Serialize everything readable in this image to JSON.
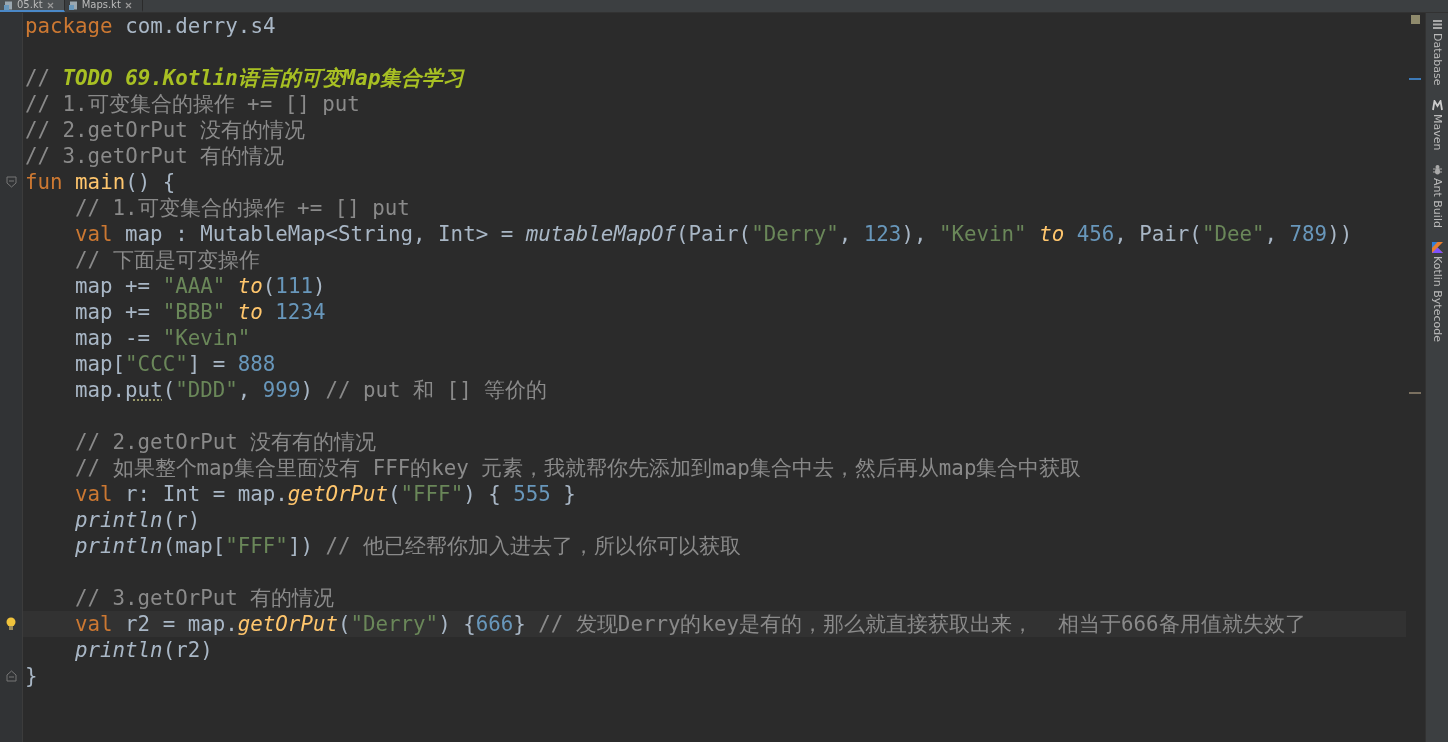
{
  "tabs": [
    {
      "label": "05.kt",
      "selected": true
    },
    {
      "label": "Maps.kt",
      "selected": false
    }
  ],
  "editor": {
    "lines": [
      {
        "kind": "code",
        "tokens": [
          {
            "kind": "kw",
            "text": "package"
          },
          {
            "kind": "txt",
            "text": " com.derry.s4"
          }
        ]
      },
      {
        "kind": "blank"
      },
      {
        "kind": "code",
        "tokens": [
          {
            "kind": "cmt",
            "text": "// "
          },
          {
            "kind": "todo",
            "text": "TODO 69.Kotlin语言的可变Map集合学习"
          }
        ]
      },
      {
        "kind": "code",
        "tokens": [
          {
            "kind": "cmt",
            "text": "// 1.可变集合的操作 += [] put"
          }
        ]
      },
      {
        "kind": "code",
        "tokens": [
          {
            "kind": "cmt",
            "text": "// 2.getOrPut 没有的情况"
          }
        ]
      },
      {
        "kind": "code",
        "tokens": [
          {
            "kind": "cmt",
            "text": "// 3.getOrPut 有的情况"
          }
        ]
      },
      {
        "kind": "code",
        "gutter_icon": {
          "kind": "fold-start"
        },
        "tokens": [
          {
            "kind": "kw",
            "text": "fun "
          },
          {
            "kind": "decl",
            "text": "main"
          },
          {
            "kind": "txt",
            "text": "() {"
          }
        ],
        "children": [
          {
            "kind": "code",
            "tokens": [
              {
                "kind": "cmt",
                "text": "// 1.可变集合的操作 += [] put"
              }
            ]
          },
          {
            "kind": "code",
            "tokens": [
              {
                "kind": "kw",
                "text": "val"
              },
              {
                "kind": "txt",
                "text": " map : MutableMap<String, Int> = "
              },
              {
                "kind": "ifn",
                "text": "mutableMapOf"
              },
              {
                "kind": "txt",
                "text": "(Pair("
              },
              {
                "kind": "str",
                "text": "\"Derry\""
              },
              {
                "kind": "txt",
                "text": ", "
              },
              {
                "kind": "num",
                "text": "123"
              },
              {
                "kind": "txt",
                "text": "), "
              },
              {
                "kind": "str",
                "text": "\"Kevin\" "
              },
              {
                "kind": "fn",
                "text": "to "
              },
              {
                "kind": "num",
                "text": "456"
              },
              {
                "kind": "txt",
                "text": ", Pair("
              },
              {
                "kind": "str",
                "text": "\"Dee\""
              },
              {
                "kind": "txt",
                "text": ", "
              },
              {
                "kind": "num",
                "text": "789"
              },
              {
                "kind": "txt",
                "text": "))"
              }
            ]
          },
          {
            "kind": "code",
            "tokens": [
              {
                "kind": "cmt",
                "text": "// 下面是可变操作"
              }
            ]
          },
          {
            "kind": "code",
            "tokens": [
              {
                "kind": "txt",
                "text": "map += "
              },
              {
                "kind": "str",
                "text": "\"AAA\" "
              },
              {
                "kind": "fn",
                "text": "to"
              },
              {
                "kind": "txt",
                "text": "("
              },
              {
                "kind": "num",
                "text": "111"
              },
              {
                "kind": "txt",
                "text": ")"
              }
            ]
          },
          {
            "kind": "code",
            "tokens": [
              {
                "kind": "txt",
                "text": "map += "
              },
              {
                "kind": "str",
                "text": "\"BBB\" "
              },
              {
                "kind": "fn",
                "text": "to "
              },
              {
                "kind": "num",
                "text": "1234"
              }
            ]
          },
          {
            "kind": "code",
            "tokens": [
              {
                "kind": "txt",
                "text": "map -= "
              },
              {
                "kind": "str",
                "text": "\"Kevin\""
              }
            ]
          },
          {
            "kind": "code",
            "tokens": [
              {
                "kind": "txt",
                "text": "map["
              },
              {
                "kind": "str",
                "text": "\"CCC\""
              },
              {
                "kind": "txt",
                "text": "] = "
              },
              {
                "kind": "num",
                "text": "888"
              }
            ]
          },
          {
            "kind": "code",
            "tokens": [
              {
                "kind": "txt",
                "text": "map."
              },
              {
                "kind": "warn",
                "text": "put"
              },
              {
                "kind": "txt",
                "text": "("
              },
              {
                "kind": "str",
                "text": "\"DDD\""
              },
              {
                "kind": "txt",
                "text": ", "
              },
              {
                "kind": "num",
                "text": "999"
              },
              {
                "kind": "txt",
                "text": ") "
              },
              {
                "kind": "cmt",
                "text": "// put 和 [] 等价的"
              }
            ]
          },
          {
            "kind": "blank"
          },
          {
            "kind": "code",
            "tokens": [
              {
                "kind": "cmt",
                "text": "// 2.getOrPut 没有有的情况"
              }
            ]
          },
          {
            "kind": "code",
            "tokens": [
              {
                "kind": "cmt",
                "text": "// 如果整个map集合里面没有 FFF的key 元素，我就帮你先添加到map集合中去，然后再从map集合中获取"
              }
            ]
          },
          {
            "kind": "code",
            "tokens": [
              {
                "kind": "kw",
                "text": "val"
              },
              {
                "kind": "txt",
                "text": " r: Int = map."
              },
              {
                "kind": "fn",
                "text": "getOrPut"
              },
              {
                "kind": "txt",
                "text": "("
              },
              {
                "kind": "str",
                "text": "\"FFF\""
              },
              {
                "kind": "txt",
                "text": ") { "
              },
              {
                "kind": "num",
                "text": "555"
              },
              {
                "kind": "txt",
                "text": " }"
              }
            ]
          },
          {
            "kind": "code",
            "tokens": [
              {
                "kind": "ifn",
                "text": "println"
              },
              {
                "kind": "txt",
                "text": "(r)"
              }
            ]
          },
          {
            "kind": "code",
            "tokens": [
              {
                "kind": "ifn",
                "text": "println"
              },
              {
                "kind": "txt",
                "text": "(map["
              },
              {
                "kind": "str",
                "text": "\"FFF\""
              },
              {
                "kind": "txt",
                "text": "]) "
              },
              {
                "kind": "cmt",
                "text": "// 他已经帮你加入进去了，所以你可以获取"
              }
            ]
          },
          {
            "kind": "blank"
          },
          {
            "kind": "code",
            "tokens": [
              {
                "kind": "cmt",
                "text": "// 3.getOrPut 有的情况"
              }
            ]
          },
          {
            "kind": "code",
            "current": true,
            "gutter_icon": {
              "kind": "bulb"
            },
            "tokens": [
              {
                "kind": "kw",
                "text": "val"
              },
              {
                "kind": "txt",
                "text": " r2 = map."
              },
              {
                "kind": "fn",
                "text": "getOrPut"
              },
              {
                "kind": "txt",
                "text": "("
              },
              {
                "kind": "str",
                "text": "\"Derry\""
              },
              {
                "kind": "txt",
                "text": ") {"
              },
              {
                "kind": "num",
                "text": "666"
              },
              {
                "kind": "txt",
                "text": "} "
              },
              {
                "kind": "cmt",
                "text": "// 发现Derry的key是有的，那么就直接获取出来，  相当于666备用值就失效了"
              }
            ]
          },
          {
            "kind": "code",
            "tokens": [
              {
                "kind": "ifn",
                "text": "println"
              },
              {
                "kind": "txt",
                "text": "(r2)"
              }
            ]
          }
        ]
      },
      {
        "kind": "code",
        "gutter_icon": {
          "kind": "fold-end"
        },
        "tokens": [
          {
            "kind": "txt",
            "text": "}"
          }
        ]
      }
    ]
  },
  "tool_windows": [
    {
      "kind": "database",
      "label": "Database"
    },
    {
      "kind": "maven",
      "label": "Maven"
    },
    {
      "kind": "ant",
      "label": "Ant Build"
    },
    {
      "kind": "kotlin",
      "label": "Kotlin Bytecode"
    }
  ]
}
